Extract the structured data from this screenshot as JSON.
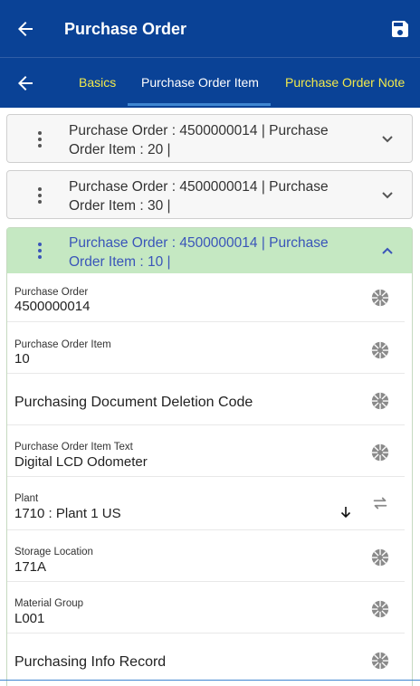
{
  "appbar": {
    "title": "Purchase Order",
    "back_icon": "arrow-left-icon",
    "save_icon": "save-icon"
  },
  "tabs": {
    "back_icon": "arrow-left-icon",
    "items": [
      {
        "label": "Basics",
        "active": false
      },
      {
        "label": "Purchase Order Item",
        "active": true
      },
      {
        "label": "Purchase Order Note",
        "active": false
      }
    ]
  },
  "items": [
    {
      "line1": "Purchase Order : 4500000014 | Purchase",
      "line2": "Order Item : 20 |",
      "expanded": false
    },
    {
      "line1": "Purchase Order : 4500000014 | Purchase",
      "line2": "Order Item : 30 |",
      "expanded": false
    },
    {
      "line1": "Purchase Order : 4500000014 | Purchase",
      "line2": "Order Item : 10 |",
      "expanded": true
    }
  ],
  "fields": [
    {
      "label": "Purchase Order",
      "value": "4500000014",
      "icon": "camera-aperture-icon"
    },
    {
      "label": "Purchase Order Item",
      "value": "10",
      "icon": "camera-aperture-icon"
    },
    {
      "label": "",
      "value": "Purchasing Document Deletion Code",
      "icon": "camera-aperture-icon"
    },
    {
      "label": "Purchase Order Item Text",
      "value": "Digital LCD Odometer",
      "icon": "camera-aperture-icon"
    },
    {
      "label": "Plant",
      "value": "1710 : Plant 1 US",
      "icon": "swap-icon",
      "dropdown_icon": "arrow-down-icon"
    },
    {
      "label": "Storage Location",
      "value": "171A",
      "icon": "camera-aperture-icon"
    },
    {
      "label": "Material Group",
      "value": "L001",
      "icon": "camera-aperture-icon"
    },
    {
      "label": "",
      "value": "Purchasing Info Record",
      "icon": "camera-aperture-icon"
    }
  ],
  "colors": {
    "primary": "#0a4296",
    "tab_inactive": "#f2e94b",
    "expanded_header": "#c5e8c2",
    "expanded_text": "#3a55b9"
  }
}
